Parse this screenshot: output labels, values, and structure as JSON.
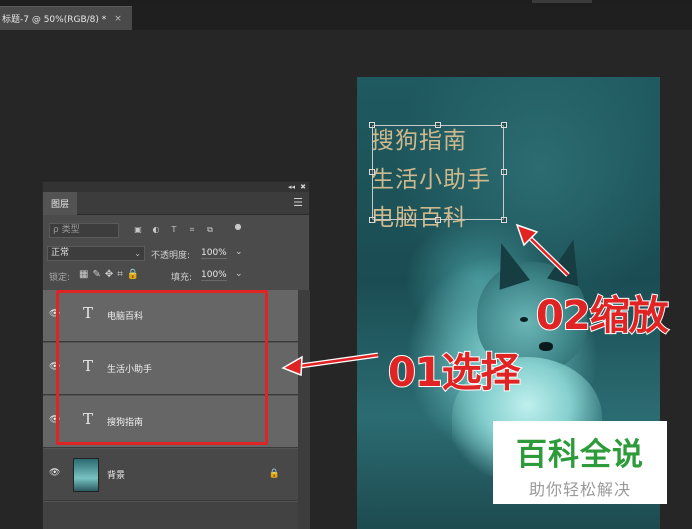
{
  "document_tab": {
    "title": "标题-7 @ 50%(RGB/8) *",
    "close": "×"
  },
  "canvas": {
    "text_lines": [
      "搜狗指南",
      "生活小助手",
      "电脑百科"
    ]
  },
  "annotations": {
    "step1": "01选择",
    "step2": "02缩放",
    "color": "#e02323"
  },
  "watermark": {
    "title": "百科全说",
    "subtitle": "助你轻松解决"
  },
  "layers_panel": {
    "tab": "图层",
    "dock_buttons": [
      "◂◂",
      "✖"
    ],
    "menu_icon": "☰",
    "filter_placeholder": "ρ 类型",
    "filter_icons": [
      "image-filter-icon",
      "adjustment-filter-icon",
      "type-filter-icon",
      "shape-filter-icon",
      "smart-object-filter-icon",
      "toggle-filter-icon"
    ],
    "blend_mode": "正常",
    "opacity_label": "不透明度:",
    "opacity_value": "100%",
    "lock_label": "锁定:",
    "fill_label": "填充:",
    "fill_value": "100%",
    "layers": [
      {
        "name": "电脑百科",
        "kind": "text",
        "type_glyph": "T"
      },
      {
        "name": "生活小助手",
        "kind": "text",
        "type_glyph": "T"
      },
      {
        "name": "搜狗指南",
        "kind": "text",
        "type_glyph": "T"
      },
      {
        "name": "背景",
        "kind": "background"
      }
    ]
  }
}
